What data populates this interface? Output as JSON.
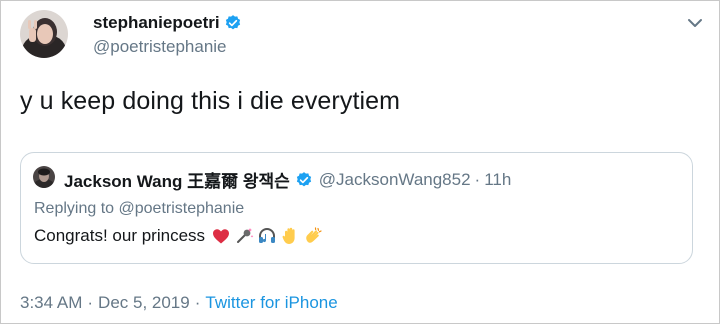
{
  "author": {
    "display_name": "stephaniepoetri",
    "handle": "@poetristephanie",
    "verified": true
  },
  "tweet": {
    "text": "y u keep doing this i die everytiem",
    "time": "3:34 AM",
    "date": "Dec 5, 2019",
    "source": "Twitter for iPhone"
  },
  "quoted_tweet": {
    "display_name": "Jackson Wang 王嘉爾 왕잭슨",
    "handle": "@JacksonWang852",
    "age": "11h",
    "replying_to_label": "Replying to",
    "replying_to_handle": "@poetristephanie",
    "text": "Congrats! our princess",
    "emojis": [
      "red-heart",
      "microphone-sparkle",
      "headphones",
      "raised-hand",
      "clapping-hands"
    ]
  },
  "colors": {
    "text_primary": "#14171a",
    "text_secondary": "#657786",
    "link": "#1b95e0",
    "verified_blue": "#1da1f2",
    "border": "#ccd6dd"
  }
}
